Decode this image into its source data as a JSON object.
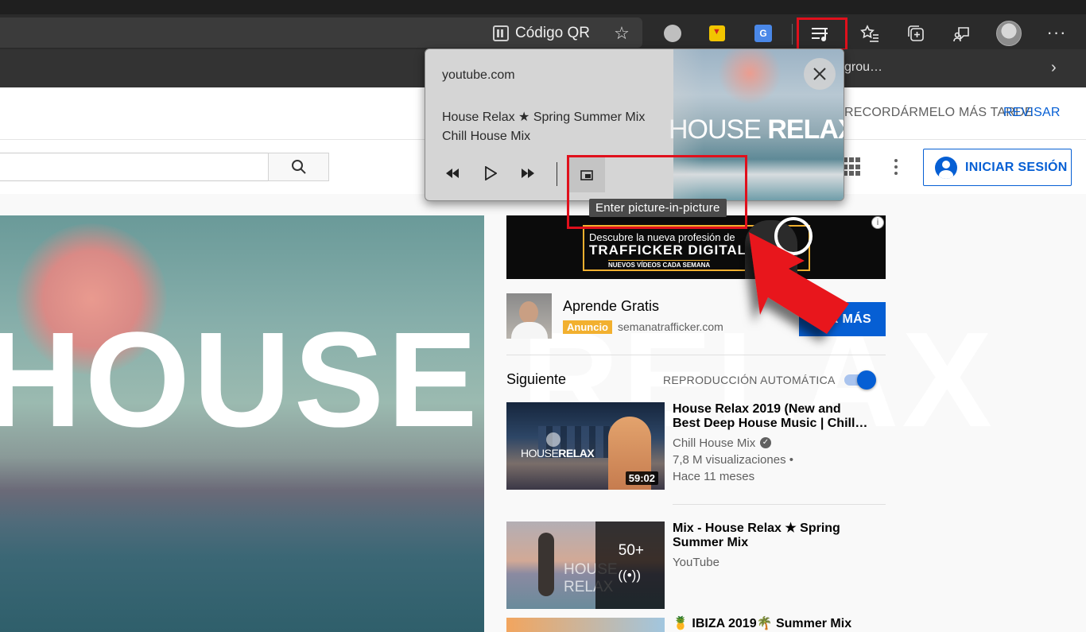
{
  "browser": {
    "address_bar": {
      "qr_label": "Código QR",
      "favorite_star": "☆"
    },
    "toolbar": {
      "extensions": [
        "downloader-extension-icon",
        "yellow-download-extension-icon",
        "google-translate-icon"
      ],
      "media_button_highlighted": true,
      "more_label": "···"
    },
    "favorites_bar": {
      "truncated_item": "grou…",
      "chevron": "›"
    },
    "accent_colors": {
      "highlight": "#e0101c",
      "chrome": "#2b2b2b"
    }
  },
  "media_popup": {
    "site": "youtube.com",
    "song": "House Relax ★ Spring Summer Mix",
    "artist": "Chill House Mix",
    "art_text_light": "HOUSE ",
    "art_text_bold": "RELAX",
    "tooltip": "Enter picture-in-picture"
  },
  "youtube": {
    "consent": {
      "remind_later": "RECORDÁRMELO MÁS TARDE",
      "review": "REVISAR"
    },
    "masthead": {
      "search_placeholder": "",
      "sign_in": "INICIAR SESIÓN"
    },
    "player": {
      "overlay_text": "HOUSE RELAX"
    },
    "ad": {
      "banner_line1": "Descubre la nueva profesión de",
      "banner_line2": "TRAFFICKER DIGITAL",
      "banner_line3": "NUEVOS VÍDEOS CADA SEMANA",
      "info": "i",
      "advertiser": "Aprende Gratis",
      "badge": "Anuncio",
      "domain": "semanatrafficker.com",
      "cta": "VER MÁS"
    },
    "up_next": {
      "heading": "Siguiente",
      "autoplay_label": "REPRODUCCIÓN AUTOMÁTICA",
      "autoplay_on": true
    },
    "recommendations": [
      {
        "title": "House Relax 2019 (New and Best Deep House Music | Chill…",
        "channel": "Chill House Mix",
        "verified": true,
        "views": "7,8 M visualizaciones •",
        "age": "Hace 11 meses",
        "thumb_text_light": "HOUSE",
        "thumb_text_bold": "RELAX",
        "duration": "59:02"
      },
      {
        "title": "Mix - House Relax ★ Spring Summer Mix",
        "channel": "YouTube",
        "thumb_count": "50+",
        "thumb_text": "HOUSE RELAX"
      },
      {
        "title": "🍍 IBIZA 2019🌴 Summer Mix"
      }
    ]
  }
}
